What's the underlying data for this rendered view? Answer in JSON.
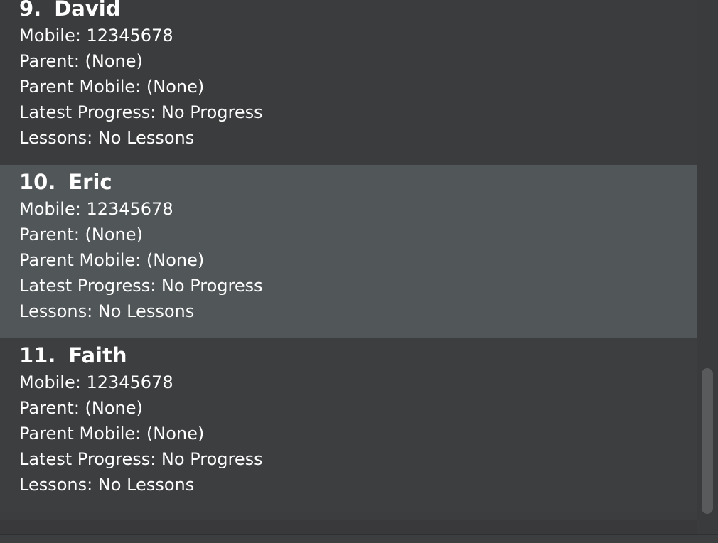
{
  "students": [
    {
      "index": "9.",
      "name": "David",
      "mobile": "Mobile: 12345678",
      "parent": "Parent: (None)",
      "parent_mobile": "Parent Mobile: (None)",
      "latest_progress": "Latest Progress: No Progress",
      "lessons": "Lessons: No Lessons"
    },
    {
      "index": "10.",
      "name": "Eric",
      "mobile": "Mobile: 12345678",
      "parent": "Parent: (None)",
      "parent_mobile": "Parent Mobile: (None)",
      "latest_progress": "Latest Progress: No Progress",
      "lessons": "Lessons: No Lessons"
    },
    {
      "index": "11.",
      "name": "Faith",
      "mobile": "Mobile: 12345678",
      "parent": "Parent: (None)",
      "parent_mobile": "Parent Mobile: (None)",
      "latest_progress": "Latest Progress: No Progress",
      "lessons": "Lessons: No Lessons"
    }
  ],
  "colors": {
    "background": "#3c3d3f",
    "selected_card": "#515659",
    "text": "#ffffff",
    "scroll_thumb": "#595a5c"
  }
}
